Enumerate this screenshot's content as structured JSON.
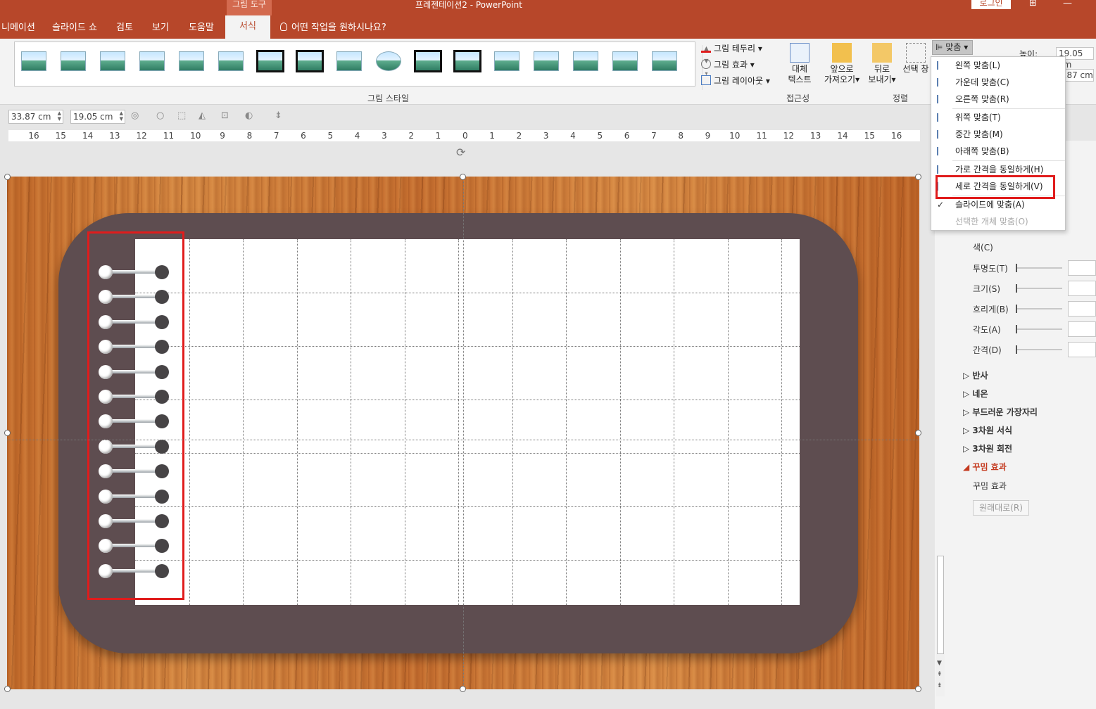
{
  "app": {
    "title": "프레젠테이션2  -  PowerPoint",
    "context_tab": "그림 도구",
    "login_label": "로그인"
  },
  "tabs": [
    {
      "label": "니메이션"
    },
    {
      "label": "슬라이드 쇼"
    },
    {
      "label": "검토"
    },
    {
      "label": "보기"
    },
    {
      "label": "도움말"
    },
    {
      "label": "서식"
    }
  ],
  "tell_me": "어떤 작업을 원하시나요?",
  "ribbon": {
    "picture_border": "그림 테두리",
    "picture_effects": "그림 효과",
    "picture_layout": "그림 레이아웃",
    "picture_styles_label": "그림 스타일",
    "alt_text_line1": "대체",
    "alt_text_line2": "텍스트",
    "accessibility_label": "접근성",
    "bring_forward_line1": "앞으로",
    "bring_forward_line2": "가져오기",
    "send_backward_line1": "뒤로",
    "send_backward_line2": "보내기",
    "selection_pane": "선택 창",
    "arrange_label": "정렬",
    "align_button": "맞춤",
    "height_label": "높이:",
    "height_value": "19.05 cm",
    "width_value": "3.87 cm"
  },
  "format_bar": {
    "width_value": "33.87 cm",
    "height_value": "19.05 cm"
  },
  "ruler": [
    "16",
    "15",
    "14",
    "13",
    "12",
    "11",
    "10",
    "9",
    "8",
    "7",
    "6",
    "5",
    "4",
    "3",
    "2",
    "1",
    "0",
    "1",
    "2",
    "3",
    "4",
    "5",
    "6",
    "7",
    "8",
    "9",
    "10",
    "11",
    "12",
    "13",
    "14",
    "15",
    "16"
  ],
  "align_menu": {
    "items": [
      {
        "label": "왼쪽 맞춤(L)"
      },
      {
        "label": "가운데 맞춤(C)"
      },
      {
        "label": "오른쪽 맞춤(R)"
      },
      {
        "label": "위쪽 맞춤(T)"
      },
      {
        "label": "중간 맞춤(M)"
      },
      {
        "label": "아래쪽 맞춤(B)"
      },
      {
        "label": "가로 간격을 동일하게(H)"
      },
      {
        "label": "세로 간격을 동일하게(V)"
      },
      {
        "label": "슬라이드에 맞춤(A)"
      },
      {
        "label": "선택한 개체 맞춤(O)"
      }
    ],
    "check_mark": "✓"
  },
  "format_pane": {
    "color": "색(C)",
    "transparency": "투명도(T)",
    "size": "크기(S)",
    "blur": "흐리게(B)",
    "angle": "각도(A)",
    "distance": "간격(D)",
    "reflection": "반사",
    "glow": "네온",
    "soft_edges": "부드러운 가장자리",
    "format_3d": "3차원 서식",
    "rotation_3d": "3차원 회전",
    "artistic_effects": "꾸밈 효과",
    "artistic_effects_sub": "꾸밈 효과",
    "reset_button": "원래대로(R)"
  }
}
